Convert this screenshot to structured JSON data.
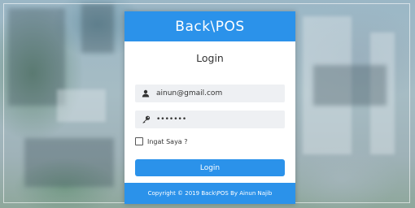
{
  "brand": {
    "title": "Back\\POS",
    "accent": "#2b92ea"
  },
  "form": {
    "heading": "Login",
    "email": {
      "value": "ainun@gmail.com",
      "icon": "user-icon"
    },
    "password": {
      "value": "•••••••",
      "icon": "key-icon"
    },
    "remember_label": "Ingat Saya ?",
    "remember_checked": false,
    "submit_label": "Login"
  },
  "footer": {
    "text": "Copyright © 2019 Back\\POS By Ainun Najib"
  }
}
